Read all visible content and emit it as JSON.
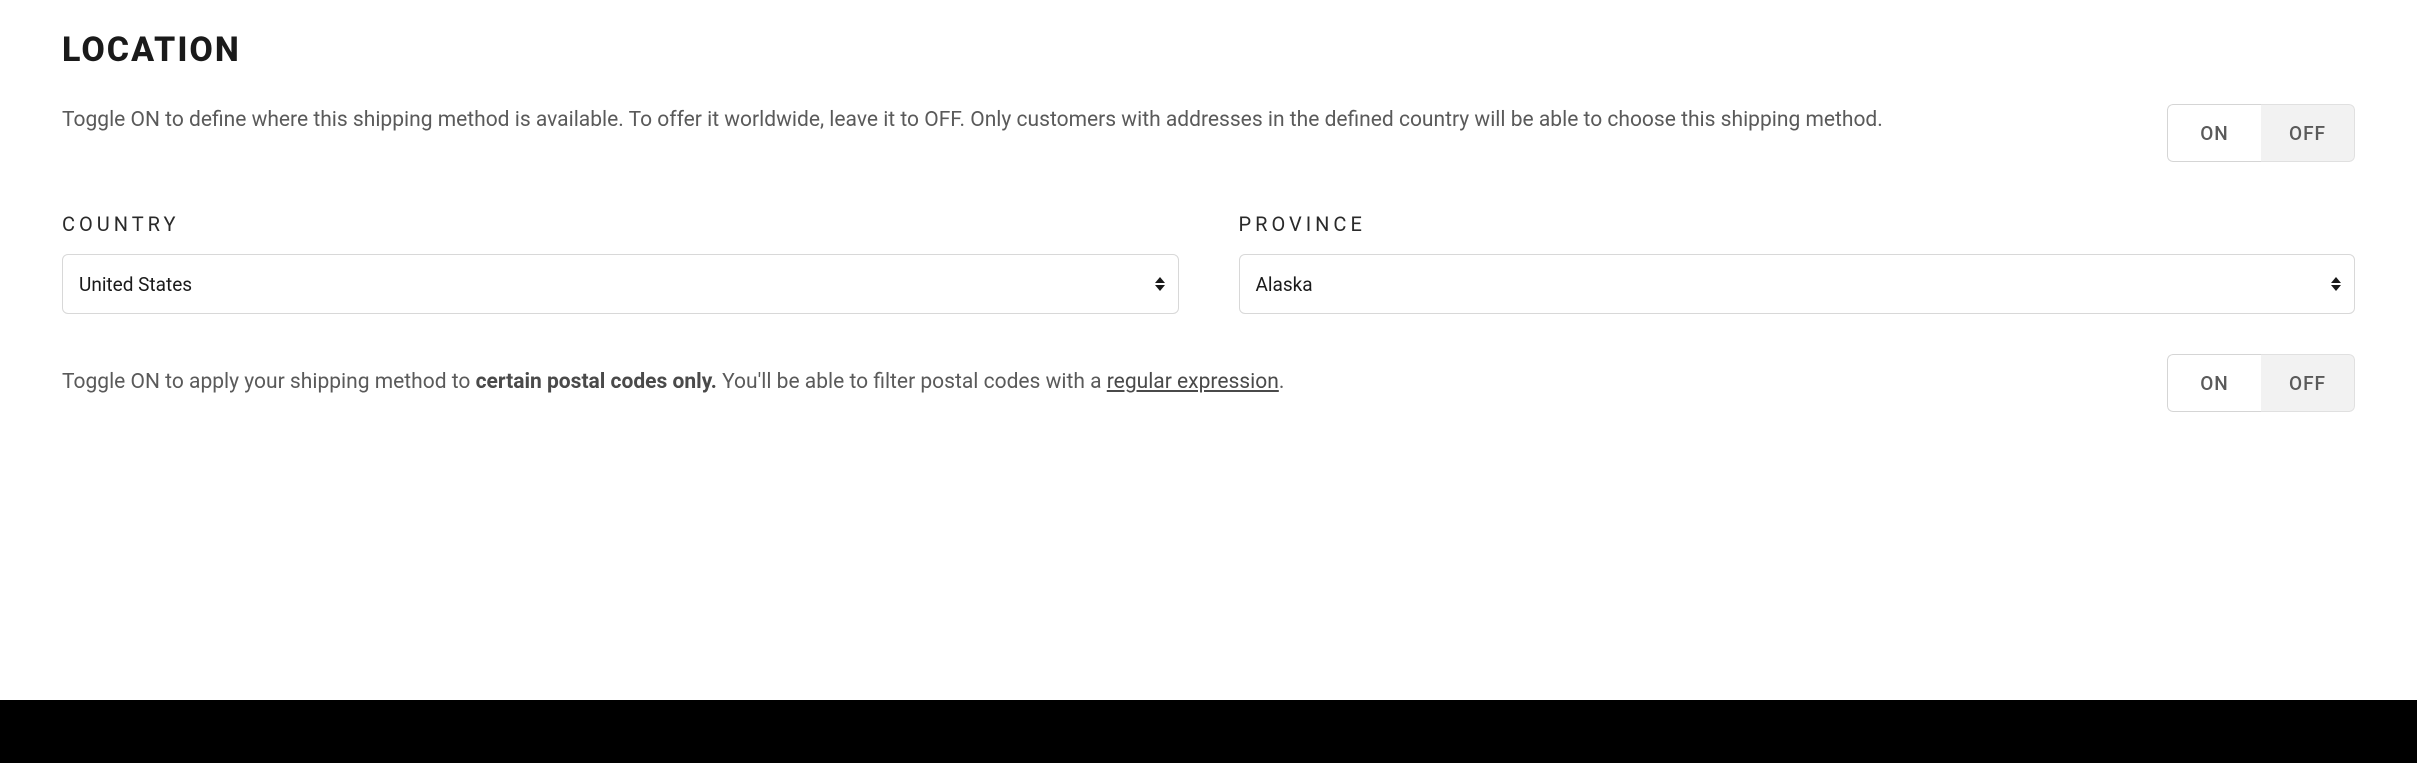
{
  "location": {
    "title": "LOCATION",
    "desc": "Toggle ON to define where this shipping method is available. To offer it worldwide, leave it to OFF. Only customers with addresses in the defined country will be able to choose this shipping method.",
    "toggle": {
      "on_label": "ON",
      "off_label": "OFF",
      "value": "ON"
    },
    "country": {
      "label": "COUNTRY",
      "value": "United States"
    },
    "province": {
      "label": "PROVINCE",
      "value": "Alaska"
    },
    "postal": {
      "desc_prefix": "Toggle ON to apply your shipping method to ",
      "desc_bold": "certain postal codes only.",
      "desc_mid": " You'll be able to filter postal codes with a ",
      "desc_link": "regular expression",
      "desc_suffix": ".",
      "toggle": {
        "on_label": "ON",
        "off_label": "OFF",
        "value": "ON"
      }
    }
  }
}
